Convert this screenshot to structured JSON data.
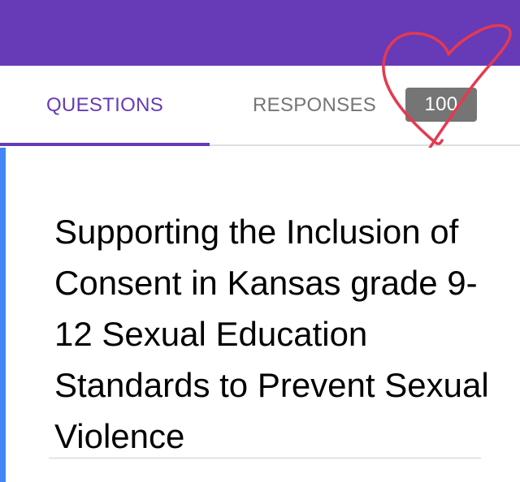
{
  "app_bar": {
    "color": "#673ab7"
  },
  "tabs": {
    "questions_label": "QUESTIONS",
    "responses_label": "RESPONSES",
    "responses_count": "100",
    "active": "questions",
    "active_color": "#673ab7"
  },
  "form": {
    "title": "Supporting the Inclusion of Consent in Kansas grade 9-12 Sexual Education Standards to Prevent Sexual Violence",
    "accent_color": "#4285f4"
  },
  "annotation": {
    "shape": "hand-drawn-heart",
    "color": "#e53950"
  }
}
